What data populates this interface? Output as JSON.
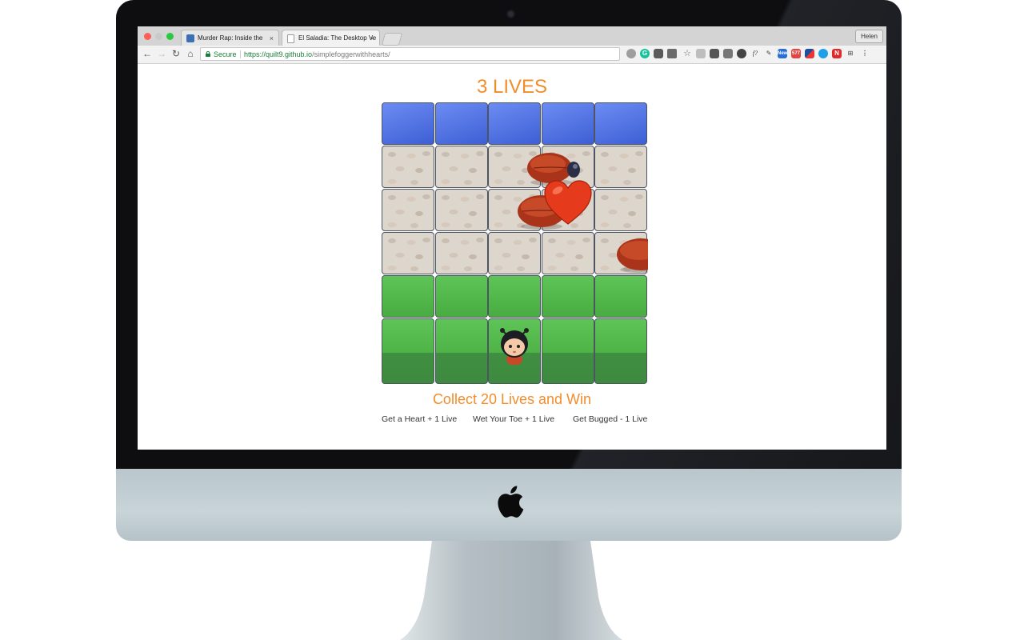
{
  "browser": {
    "tabs": [
      {
        "title": "Murder Rap: Inside the",
        "close": "×"
      },
      {
        "title": "El Saladia: The Desktop Ve",
        "close": "×"
      }
    ],
    "user_button": "Helen",
    "security_label": "Secure",
    "url_host": "https://quilt9.github.io",
    "url_path": "/simplefoggerwithhearts/",
    "extension_badges": {
      "new": "New",
      "count": "577"
    }
  },
  "game": {
    "lives_text": "3 LIVES",
    "lives": 3,
    "goal_text": "Collect 20 Lives and Win",
    "rules": [
      "Get a Heart + 1 Live",
      "Wet Your Toe + 1 Live",
      "Get Bugged - 1 Live"
    ],
    "grid": {
      "columns": 5,
      "rows": [
        "water",
        "stone",
        "stone",
        "stone",
        "grass",
        "grass"
      ]
    },
    "colors": {
      "accent": "#f28d2b",
      "water": "#4f6fe0",
      "grass": "#56bd4f",
      "stone": "#ddd6cd",
      "bug": "#b8391c",
      "heart": "#e63a1d"
    }
  }
}
